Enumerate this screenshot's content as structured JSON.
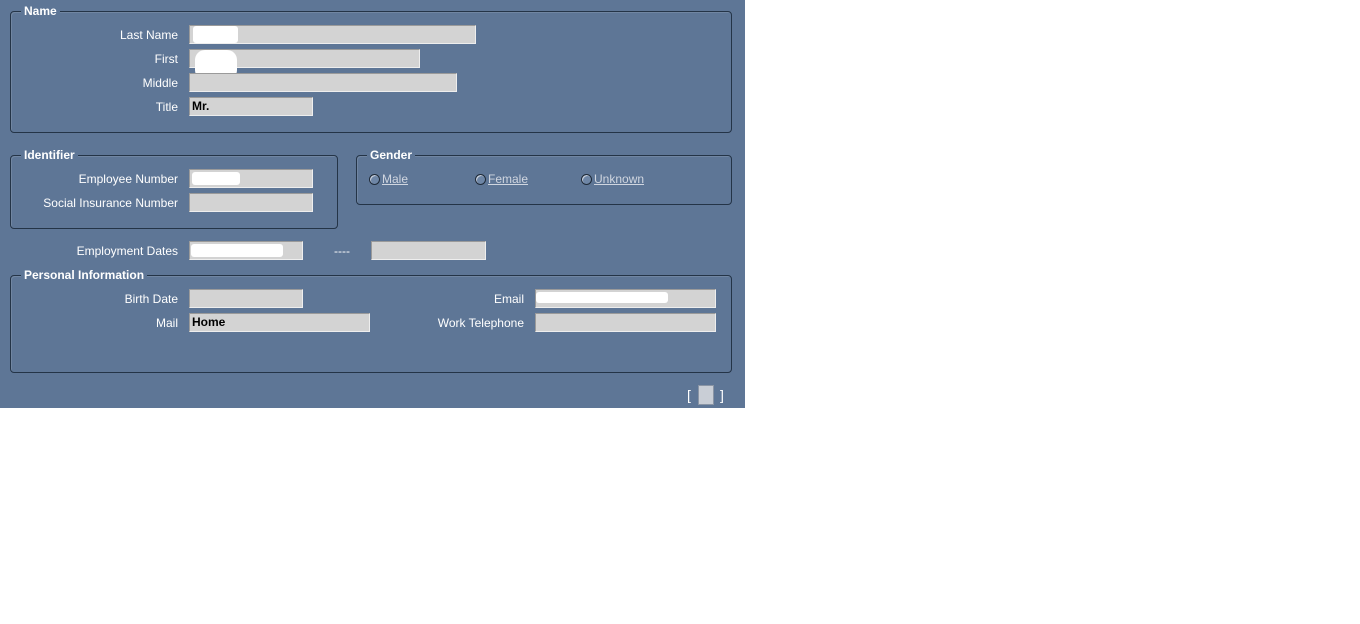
{
  "name_group": {
    "legend": "Name",
    "last_name_label": "Last Name",
    "first_label": "First",
    "middle_label": "Middle",
    "title_label": "Title",
    "last_name_value": "",
    "first_value": "",
    "middle_value": "",
    "title_value": "Mr."
  },
  "identifier_group": {
    "legend": "Identifier",
    "employee_number_label": "Employee Number",
    "sin_label": "Social Insurance Number",
    "employee_number_value": "",
    "sin_value": ""
  },
  "gender_group": {
    "legend": "Gender",
    "options": [
      "Male",
      "Female",
      "Unknown"
    ]
  },
  "employment": {
    "label": "Employment Dates",
    "separator": "----",
    "start_value": "",
    "end_value": ""
  },
  "personal_group": {
    "legend": "Personal Information",
    "birth_date_label": "Birth Date",
    "mail_label": "Mail",
    "email_label": "Email",
    "work_phone_label": "Work Telephone",
    "birth_date_value": "",
    "mail_value": "Home",
    "email_value": "",
    "work_phone_value": ""
  },
  "footer": {
    "bracket_open": "[",
    "bracket_close": "]"
  },
  "colors": {
    "panel_bg": "#5e7696",
    "field_bg": "#d3d3d3"
  }
}
